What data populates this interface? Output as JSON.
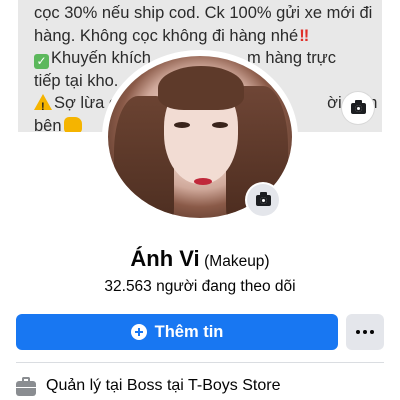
{
  "cover": {
    "lines": [
      "cọc 30% nếu ship cod. Ck 100% gửi xe mới đi",
      "hàng. Không cọc không đi hàng nhé",
      "Khuyến khích",
      "m hàng trực",
      "tiếp tại kho.",
      "Sợ lừa c",
      "ời gian c",
      "bên"
    ]
  },
  "profile": {
    "name": "Ánh Vi",
    "role": "(Makeup)",
    "followers": "32.563 người đang theo dõi"
  },
  "actions": {
    "add_info_label": "Thêm tin"
  },
  "work": {
    "text": "Quản lý tại Boss tại T-Boys Store"
  },
  "icons": {
    "cover_camera": "camera-icon",
    "avatar_camera": "camera-icon",
    "add": "plus-circle-icon",
    "more": "more-dots-icon",
    "work": "briefcase-icon"
  },
  "colors": {
    "primary": "#1877f2",
    "secondary_button": "#e4e6eb",
    "cover_bg": "#e8e8e8"
  }
}
